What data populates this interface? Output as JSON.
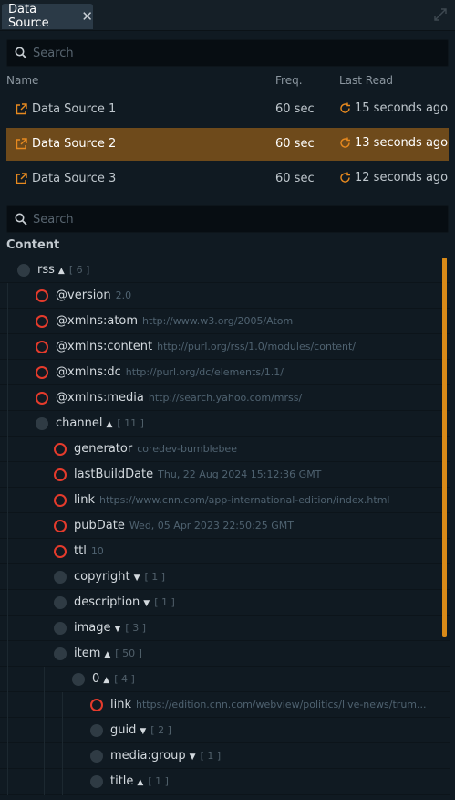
{
  "tab": {
    "title": "Data Source",
    "close": "✕"
  },
  "search1": {
    "placeholder": "Search"
  },
  "search2": {
    "placeholder": "Search"
  },
  "columns": {
    "name": "Name",
    "freq": "Freq.",
    "last_read": "Last Read"
  },
  "sources": [
    {
      "name": "Data Source 1",
      "freq": "60 sec",
      "last_read": "15 seconds ago",
      "selected": false
    },
    {
      "name": "Data Source 2",
      "freq": "60 sec",
      "last_read": "13 seconds ago",
      "selected": true
    },
    {
      "name": "Data Source 3",
      "freq": "60 sec",
      "last_read": "12 seconds ago",
      "selected": false
    }
  ],
  "content_label": "Content",
  "colors": {
    "accent": "#e88a1f",
    "selected_row": "#6e4a1b",
    "attr_ring": "#e53b2c"
  },
  "tree": [
    {
      "level": 0,
      "kind": "node",
      "label": "rss",
      "expanded": true,
      "count": "[ 6 ]"
    },
    {
      "level": 1,
      "kind": "attr",
      "label": "@version",
      "value": "2.0"
    },
    {
      "level": 1,
      "kind": "attr",
      "label": "@xmlns:atom",
      "value": "http://www.w3.org/2005/Atom"
    },
    {
      "level": 1,
      "kind": "attr",
      "label": "@xmlns:content",
      "value": "http://purl.org/rss/1.0/modules/content/"
    },
    {
      "level": 1,
      "kind": "attr",
      "label": "@xmlns:dc",
      "value": "http://purl.org/dc/elements/1.1/"
    },
    {
      "level": 1,
      "kind": "attr",
      "label": "@xmlns:media",
      "value": "http://search.yahoo.com/mrss/"
    },
    {
      "level": 1,
      "kind": "node",
      "label": "channel",
      "expanded": true,
      "count": "[ 11 ]"
    },
    {
      "level": 2,
      "kind": "attr",
      "label": "generator",
      "value": "coredev-bumblebee"
    },
    {
      "level": 2,
      "kind": "attr",
      "label": "lastBuildDate",
      "value": "Thu, 22 Aug 2024 15:12:36 GMT"
    },
    {
      "level": 2,
      "kind": "attr",
      "label": "link",
      "value": "https://www.cnn.com/app-international-edition/index.html"
    },
    {
      "level": 2,
      "kind": "attr",
      "label": "pubDate",
      "value": "Wed, 05 Apr 2023 22:50:25 GMT"
    },
    {
      "level": 2,
      "kind": "attr",
      "label": "ttl",
      "value": "10"
    },
    {
      "level": 2,
      "kind": "node",
      "label": "copyright",
      "expanded": false,
      "count": "[ 1 ]"
    },
    {
      "level": 2,
      "kind": "node",
      "label": "description",
      "expanded": false,
      "count": "[ 1 ]"
    },
    {
      "level": 2,
      "kind": "node",
      "label": "image",
      "expanded": false,
      "count": "[ 3 ]"
    },
    {
      "level": 2,
      "kind": "node",
      "label": "item",
      "expanded": true,
      "count": "[ 50 ]"
    },
    {
      "level": 3,
      "kind": "node",
      "label": "0",
      "expanded": true,
      "count": "[ 4 ]"
    },
    {
      "level": 4,
      "kind": "attr",
      "label": "link",
      "value": "https://edition.cnn.com/webview/politics/live-news/trum..."
    },
    {
      "level": 4,
      "kind": "node",
      "label": "guid",
      "expanded": false,
      "count": "[ 2 ]"
    },
    {
      "level": 4,
      "kind": "node",
      "label": "media:group",
      "expanded": false,
      "count": "[ 1 ]"
    },
    {
      "level": 4,
      "kind": "node",
      "label": "title",
      "expanded": true,
      "count": "[ 1 ]"
    }
  ]
}
